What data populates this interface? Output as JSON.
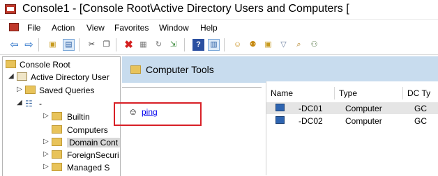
{
  "window": {
    "title": "Console1 - [Console Root\\Active Directory Users and Computers ["
  },
  "menu": {
    "items": [
      "File",
      "Action",
      "View",
      "Favorites",
      "Window",
      "Help"
    ]
  },
  "toolbar": {
    "icons": [
      "back-arrow-icon",
      "forward-arrow-icon",
      "up-folder-icon",
      "show-console-tree-icon",
      "cut-icon",
      "copy-icon",
      "delete-icon",
      "properties-icon",
      "refresh-icon",
      "export-list-icon",
      "help-icon",
      "show-action-pane-icon",
      "new-user-icon",
      "new-group-icon",
      "new-ou-icon",
      "filter-icon",
      "find-icon",
      "add-to-group-icon"
    ]
  },
  "tree": {
    "items": [
      {
        "label": "Console Root"
      },
      {
        "label": "Active Directory User"
      },
      {
        "label": "Saved Queries"
      },
      {
        "label": "-"
      },
      {
        "label": "Builtin"
      },
      {
        "label": "Computers"
      },
      {
        "label": "Domain Cont"
      },
      {
        "label": "ForeignSecuri"
      },
      {
        "label": "Managed S"
      }
    ]
  },
  "tools": {
    "title": "Computer Tools",
    "tool_link": "ping"
  },
  "listview": {
    "columns": [
      "Name",
      "Type",
      "DC Ty"
    ],
    "rows": [
      {
        "name": "-DC01",
        "type": "Computer",
        "dc_type": "GC"
      },
      {
        "name": "-DC02",
        "type": "Computer",
        "dc_type": "GC"
      }
    ]
  },
  "colors": {
    "header_bg": "#c8dcee",
    "highlight_border": "#d81f26",
    "link": "#0000ee"
  }
}
